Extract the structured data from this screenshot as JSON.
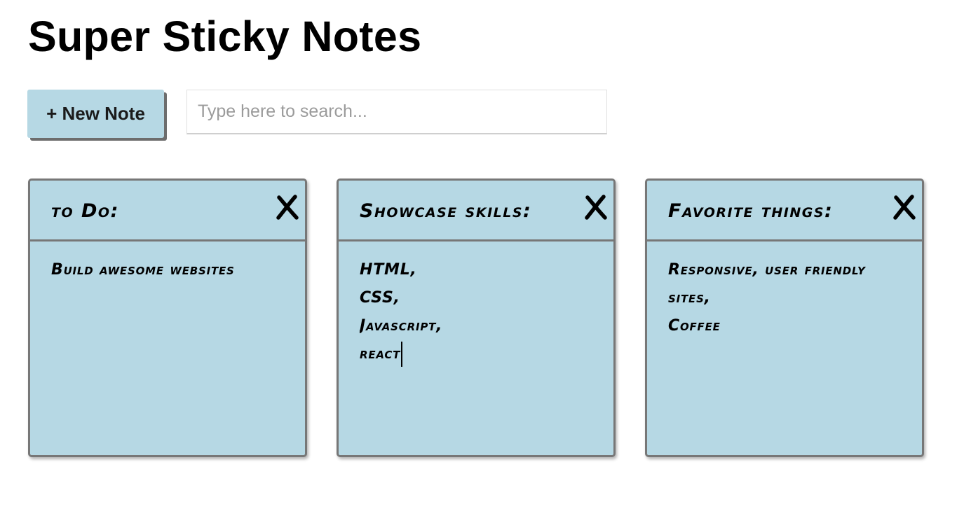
{
  "app": {
    "title": "Super Sticky Notes"
  },
  "controls": {
    "new_note_label": "+ New Note",
    "search": {
      "value": "",
      "placeholder": "Type here to search..."
    }
  },
  "notes": [
    {
      "title": "to Do:",
      "body": "Build awesome websites",
      "delete_label": "X"
    },
    {
      "title": "Showcase skills:",
      "body": "HTML,\nCSS,\nJavascript,\nreact",
      "delete_label": "X"
    },
    {
      "title": "Favorite things:",
      "body": "Responsive, user friendly\nsites,\nCoffee",
      "delete_label": "X"
    }
  ],
  "colors": {
    "note_background": "#b6d8e4",
    "note_border": "#777777",
    "button_shadow": "#6d6d6d"
  },
  "icons": {
    "delete": "close-icon"
  }
}
